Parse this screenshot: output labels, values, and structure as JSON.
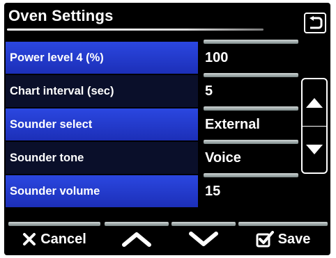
{
  "header": {
    "title": "Oven Settings"
  },
  "settings": [
    {
      "label": "Power level 4 (%)",
      "value": "100",
      "selected": true
    },
    {
      "label": "Chart interval (sec)",
      "value": "5",
      "selected": false
    },
    {
      "label": "Sounder select",
      "value": "External",
      "selected": true
    },
    {
      "label": "Sounder tone",
      "value": "Voice",
      "selected": false
    },
    {
      "label": "Sounder volume",
      "value": "15",
      "selected": true
    }
  ],
  "footer": {
    "cancel_label": "Cancel",
    "save_label": "Save"
  },
  "colors": {
    "selected_row": "#2b47e0",
    "unselected_row": "#0a0f2a",
    "background": "#000000",
    "text": "#ffffff"
  }
}
